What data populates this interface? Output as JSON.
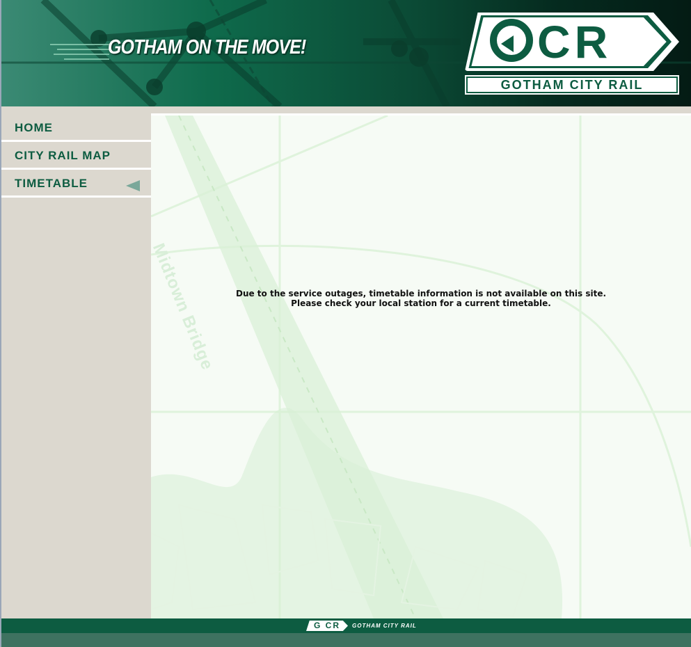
{
  "header": {
    "slogan": "GOTHAM ON THE MOVE!",
    "logo_letters": "CR",
    "logo_name": "GOTHAM CITY RAIL"
  },
  "nav": {
    "items": [
      {
        "label": "HOME",
        "active": false
      },
      {
        "label": "CITY RAIL MAP",
        "active": false
      },
      {
        "label": "TIMETABLE",
        "active": true
      }
    ]
  },
  "main": {
    "notice_line1": "Due to the service outages, timetable information is not available on this site.",
    "notice_line2": "Please check your local station for a current timetable.",
    "map_label": "Midtown Bridge"
  },
  "footer": {
    "logo_letters": "G CR",
    "logo_name": "GOTHAM CITY RAIL"
  },
  "colors": {
    "brand_green": "#0d5c41",
    "sidebar_bg": "#dcd8cf",
    "content_bg": "#f6fbf5",
    "footer_bottom": "#3e7260"
  }
}
